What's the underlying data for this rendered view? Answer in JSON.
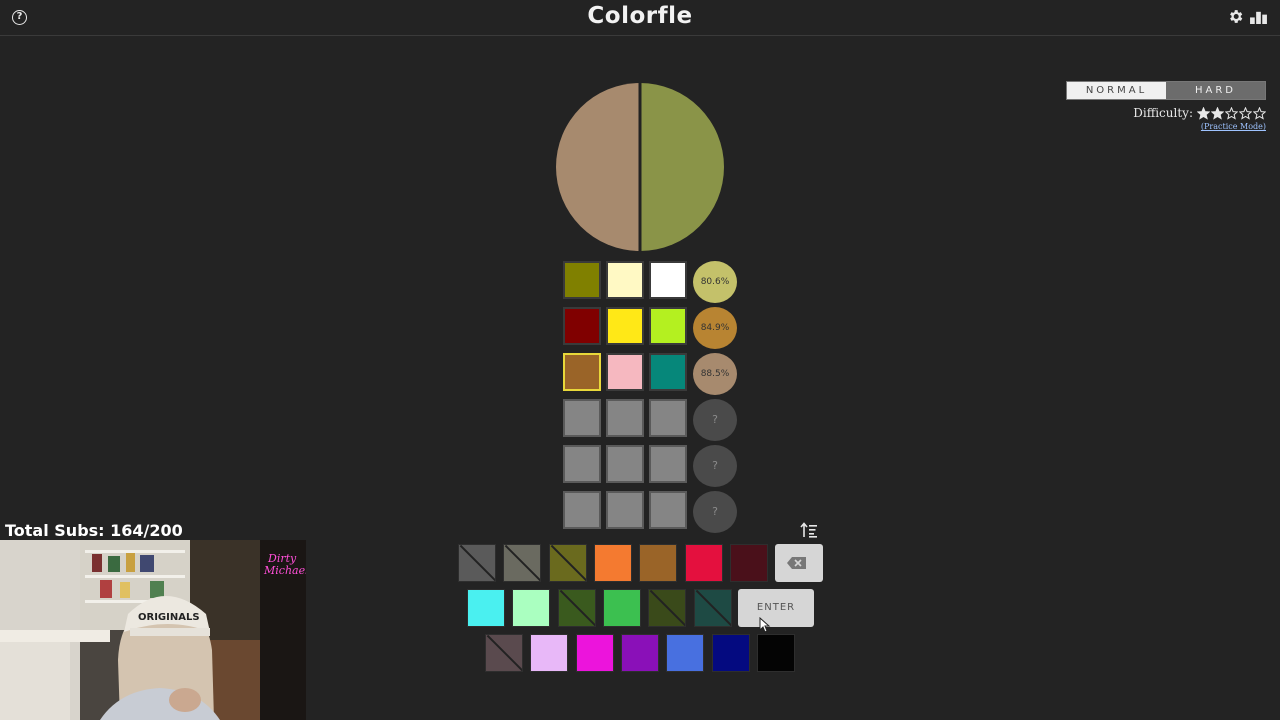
{
  "app": {
    "title": "Colorfle",
    "help_glyph": "?"
  },
  "mode": {
    "normal_label": "NORMAL",
    "hard_label": "HARD",
    "selected": "NORMAL"
  },
  "difficulty": {
    "label": "Difficulty:",
    "stars_filled": 2,
    "stars_total": 5,
    "practice_label": "(Practice Mode)"
  },
  "target": {
    "left_color": "#a78a6e",
    "right_color": "#8a9448",
    "divider_color": "#222222"
  },
  "guesses": [
    {
      "colors": [
        "#808000",
        "#fff9c4",
        "#ffffff"
      ],
      "score": "80.6%",
      "score_color": "#c4c16a",
      "selected_index": null
    },
    {
      "colors": [
        "#800000",
        "#ffe817",
        "#b4f020"
      ],
      "score": "84.9%",
      "score_color": "#b88432",
      "selected_index": null
    },
    {
      "colors": [
        "#9a6428",
        "#f6b8c0",
        "#06877a"
      ],
      "score": "88.5%",
      "score_color": "#a78a6e",
      "selected_index": 0
    },
    {
      "colors": [],
      "score": "?",
      "score_color": "",
      "selected_index": null
    },
    {
      "colors": [],
      "score": "?",
      "score_color": "",
      "selected_index": null
    },
    {
      "colors": [],
      "score": "?",
      "score_color": "",
      "selected_index": null
    }
  ],
  "palette": {
    "row1": [
      {
        "color": "#5a5a5a",
        "used": true
      },
      {
        "color": "#6a6a60",
        "used": true
      },
      {
        "color": "#6a6a1e",
        "used": true
      },
      {
        "color": "#f47a30",
        "used": false
      },
      {
        "color": "#9a6428",
        "used": false
      },
      {
        "color": "#e4103e",
        "used": false
      },
      {
        "color": "#4a101a",
        "used": false
      }
    ],
    "row2": [
      {
        "color": "#4af0f0",
        "used": false
      },
      {
        "color": "#aaffc0",
        "used": false
      },
      {
        "color": "#3a5a1e",
        "used": true
      },
      {
        "color": "#3cc050",
        "used": false
      },
      {
        "color": "#3a4a1a",
        "used": true
      },
      {
        "color": "#1e4a44",
        "used": true
      }
    ],
    "row3": [
      {
        "color": "#5a4a4e",
        "used": true
      },
      {
        "color": "#e8b8f8",
        "used": false
      },
      {
        "color": "#ec14dc",
        "used": false
      },
      {
        "color": "#8a10b8",
        "used": false
      },
      {
        "color": "#4870e0",
        "used": false
      },
      {
        "color": "#040a80",
        "used": false
      },
      {
        "color": "#040404",
        "used": false
      }
    ],
    "enter_label": "ENTER"
  },
  "stream": {
    "subs_label": "Total Subs: 164/200"
  }
}
